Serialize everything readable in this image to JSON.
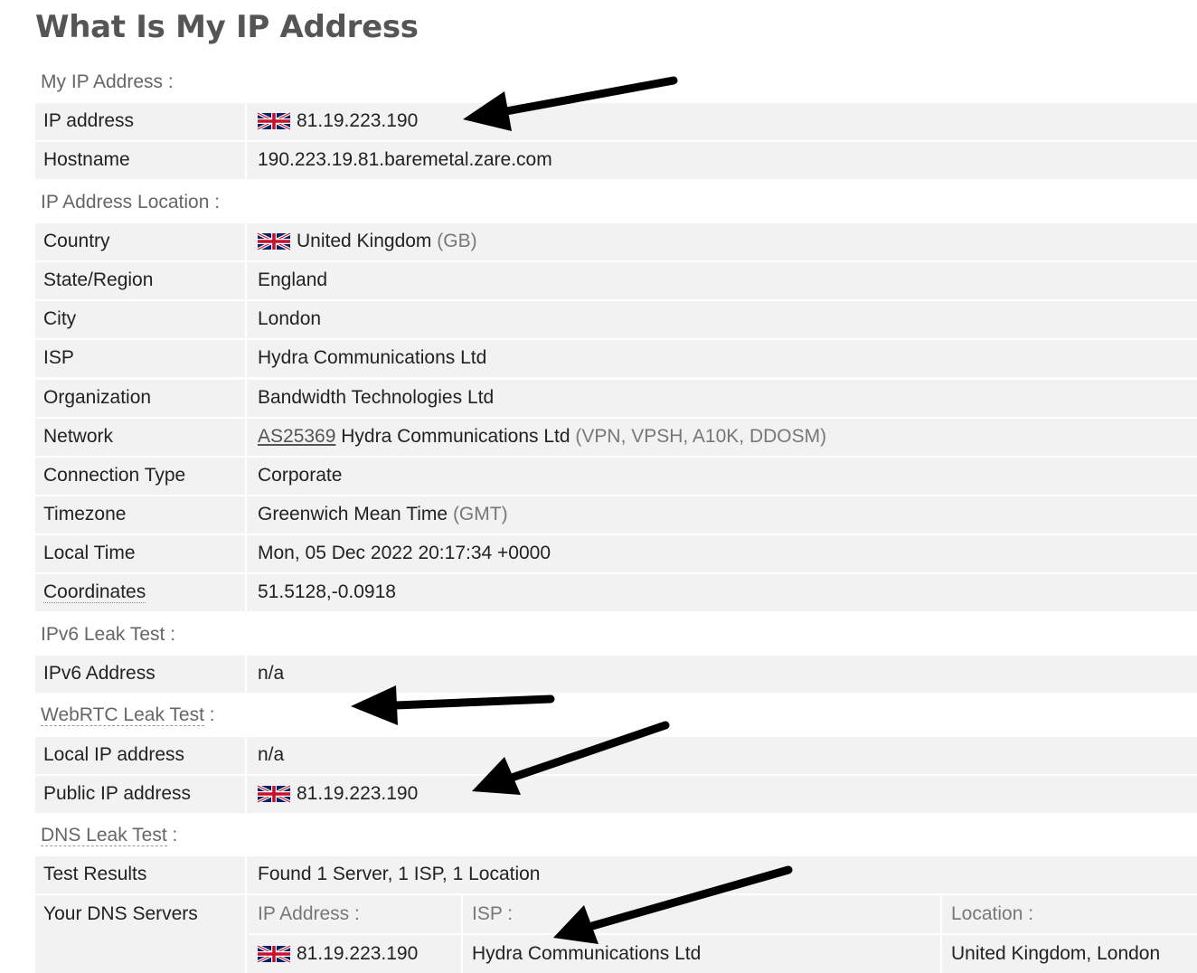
{
  "page_title": "What Is My IP Address",
  "sections": {
    "my_ip": "My IP Address",
    "location": "IP Address Location",
    "ipv6": "IPv6 Leak Test",
    "webrtc": "WebRTC Leak Test",
    "dns": "DNS Leak Test",
    "colon": ":"
  },
  "my_ip": {
    "ip_label": "IP address",
    "ip_value": "81.19.223.190",
    "host_label": "Hostname",
    "host_value": "190.223.19.81.baremetal.zare.com"
  },
  "location": {
    "country_label": "Country",
    "country_value": "United Kingdom",
    "country_code": "(GB)",
    "state_label": "State/Region",
    "state_value": "England",
    "city_label": "City",
    "city_value": "London",
    "isp_label": "ISP",
    "isp_value": "Hydra Communications Ltd",
    "org_label": "Organization",
    "org_value": "Bandwidth Technologies Ltd",
    "network_label": "Network",
    "network_asn": "AS25369",
    "network_name": "Hydra Communications Ltd",
    "network_tags": "(VPN, VPSH, A10K, DDOSM)",
    "conn_label": "Connection Type",
    "conn_value": "Corporate",
    "tz_label": "Timezone",
    "tz_value": "Greenwich Mean Time",
    "tz_code": "(GMT)",
    "time_label": "Local Time",
    "time_value": "Mon, 05 Dec 2022 20:17:34 +0000",
    "coord_label": "Coordinates",
    "coord_value": "51.5128,-0.0918"
  },
  "ipv6": {
    "label": "IPv6 Address",
    "value": "n/a"
  },
  "webrtc": {
    "local_label": "Local IP address",
    "local_value": "n/a",
    "public_label": "Public IP address",
    "public_value": "81.19.223.190"
  },
  "dns": {
    "results_label": "Test Results",
    "results_value": "Found 1 Server, 1 ISP, 1 Location",
    "servers_label": "Your DNS Servers",
    "col_ip": "IP Address :",
    "col_isp": "ISP :",
    "col_location": "Location :",
    "server_ip": "81.19.223.190",
    "server_isp": "Hydra Communications Ltd",
    "server_location": "United Kingdom, London"
  },
  "icons": {
    "flag": "uk-flag-icon",
    "arrow": "annotation-arrow"
  },
  "colors": {
    "row_bg": "#f2f2f2",
    "title": "#555555",
    "section": "#666666",
    "muted": "#777777"
  }
}
